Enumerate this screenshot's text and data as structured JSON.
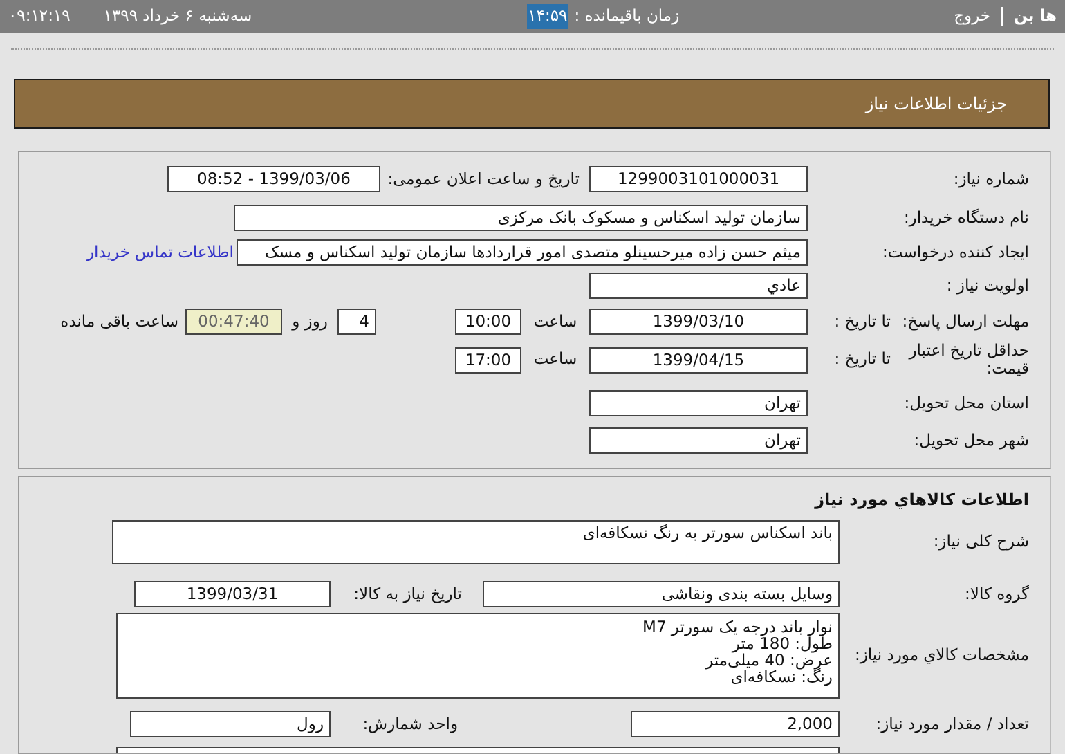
{
  "top_bar": {
    "user": "ها بن",
    "logout": "خروج",
    "remaining_label": "زمان باقیمانده :",
    "remaining_time": "۱۴:۵۹",
    "clock": "۰۹:۱۲:۱۹",
    "date": "سه‌شنبه ۶ خرداد ۱۳۹۹"
  },
  "page_title": "جزئیات اطلاعات نیاز",
  "need_info": {
    "need_number": {
      "label": "شماره نیاز:",
      "value": "1299003101000031"
    },
    "announce": {
      "label": "تاریخ و ساعت اعلان عمومی:",
      "value": "1399/03/06 - 08:52"
    },
    "buyer": {
      "label": "نام دستگاه خریدار:",
      "value": "سازمان تولید اسکناس و مسکوک بانک مرکزی"
    },
    "creator": {
      "label": "ایجاد کننده درخواست:",
      "value": "میثم حسن زاده میرحسینلو متصدی امور قراردادها سازمان تولید اسکناس و مسک",
      "link": "اطلاعات تماس خریدار"
    },
    "priority": {
      "label": "اولویت نیاز :",
      "value": "عادي"
    },
    "deadline": {
      "label": "مهلت ارسال پاسخ:",
      "to_label": "تا تاریخ :",
      "date": "1399/03/10",
      "time_label": "ساعت",
      "time": "10:00",
      "days": "4",
      "days_label": "روز و",
      "remaining": "00:47:40",
      "remaining_label": "ساعت باقی مانده"
    },
    "validity": {
      "label": "حداقل تاریخ اعتبار قیمت:",
      "to_label": "تا تاریخ :",
      "date": "1399/04/15",
      "time_label": "ساعت",
      "time": "17:00"
    },
    "province": {
      "label": "استان محل تحویل:",
      "value": "تهران"
    },
    "city": {
      "label": "شهر محل تحویل:",
      "value": "تهران"
    }
  },
  "goods": {
    "title": "اطلاعات كالاهاي مورد نياز",
    "description": {
      "label": "شرح کلی نیاز:",
      "value": "باند اسکناس سورتر به رنگ نسکافه‌ای"
    },
    "group": {
      "label": "گروه کالا:",
      "value": "وسایل بسته بندی  ونقاشی",
      "date_label": "تاریخ نیاز به کالا:",
      "date": "1399/03/31"
    },
    "specs": {
      "label": "مشخصات كالاي مورد نياز:",
      "lines": [
        "نوار باند درجه یک سورتر M7",
        "طول: 180 متر",
        "عرض: 40 میلی‌متر",
        "رنگ: نسکافه‌ای"
      ]
    },
    "quantity": {
      "label": "تعداد / مقدار مورد نیاز:",
      "value": "2,000",
      "unit_label": "واحد شمارش:",
      "unit": "رول"
    }
  }
}
